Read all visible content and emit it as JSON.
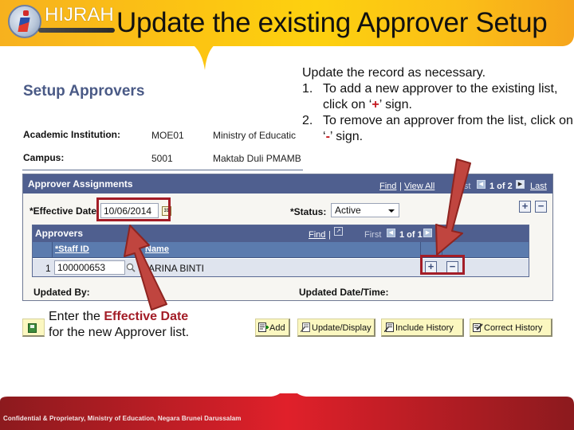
{
  "slide": {
    "title": "Update the existing Approver Setup",
    "logo_text": "HIJRAH",
    "footer": "Confidential & Proprietary, Ministry of Education, Negara Brunei Darussalam"
  },
  "colors": {
    "banner": "#fcc512",
    "footer": "#c41e25",
    "highlight": "#a31d27",
    "panel_header": "#4f5f8f",
    "column_header": "#5b7bae",
    "page_heading": "#4a5a86"
  },
  "page": {
    "heading": "Setup Approvers",
    "fields": [
      {
        "label": "Academic Institution:",
        "code": "MOE01",
        "description": "Ministry of Educatic"
      },
      {
        "label": "Campus:",
        "code": "5001",
        "description": "Maktab Duli PMAMB"
      }
    ],
    "assignments": {
      "title": "Approver Assignments",
      "find": "Find",
      "separator": "|",
      "view_all": "View All",
      "first": "First",
      "count": "1 of 2",
      "last": "Last",
      "effective_date_label": "*Effective Date:",
      "effective_date_value": "10/06/2014",
      "calendar_icon": "31",
      "status_label": "*Status:",
      "status_value": "Active",
      "add_icon": "+",
      "remove_icon": "−",
      "approvers_grid": {
        "title": "Approvers",
        "find": "Find",
        "separator": "|",
        "first": "First",
        "count": "1 of 1",
        "last": "Last",
        "columns": [
          "*Staff ID",
          "Name"
        ],
        "rows": [
          {
            "num": "1",
            "staff_id": "100000653",
            "name": "ARINA BINTI"
          }
        ],
        "add_icon": "+",
        "remove_icon": "−"
      },
      "updated_by_label": "Updated By:",
      "updated_datetime_label": "Updated Date/Time:"
    },
    "toolbar": {
      "add": "Add",
      "update_display": "Update/Display",
      "include_history": "Include History",
      "correct_history": "Correct History"
    }
  },
  "callouts": {
    "right": {
      "lead": "Update the record as necessary.",
      "items": [
        {
          "num": "1.",
          "pre": "To add a new approver to the existing list, click on ‘",
          "sign": "+",
          "post": "’ sign."
        },
        {
          "num": "2.",
          "pre": "To remove an approver from the list, click on ‘",
          "sign": "-",
          "post": "’ sign."
        }
      ]
    },
    "left": {
      "pre": "Enter the ",
      "emphasis": "Effective Date",
      "post": "for the new Approver list."
    }
  }
}
